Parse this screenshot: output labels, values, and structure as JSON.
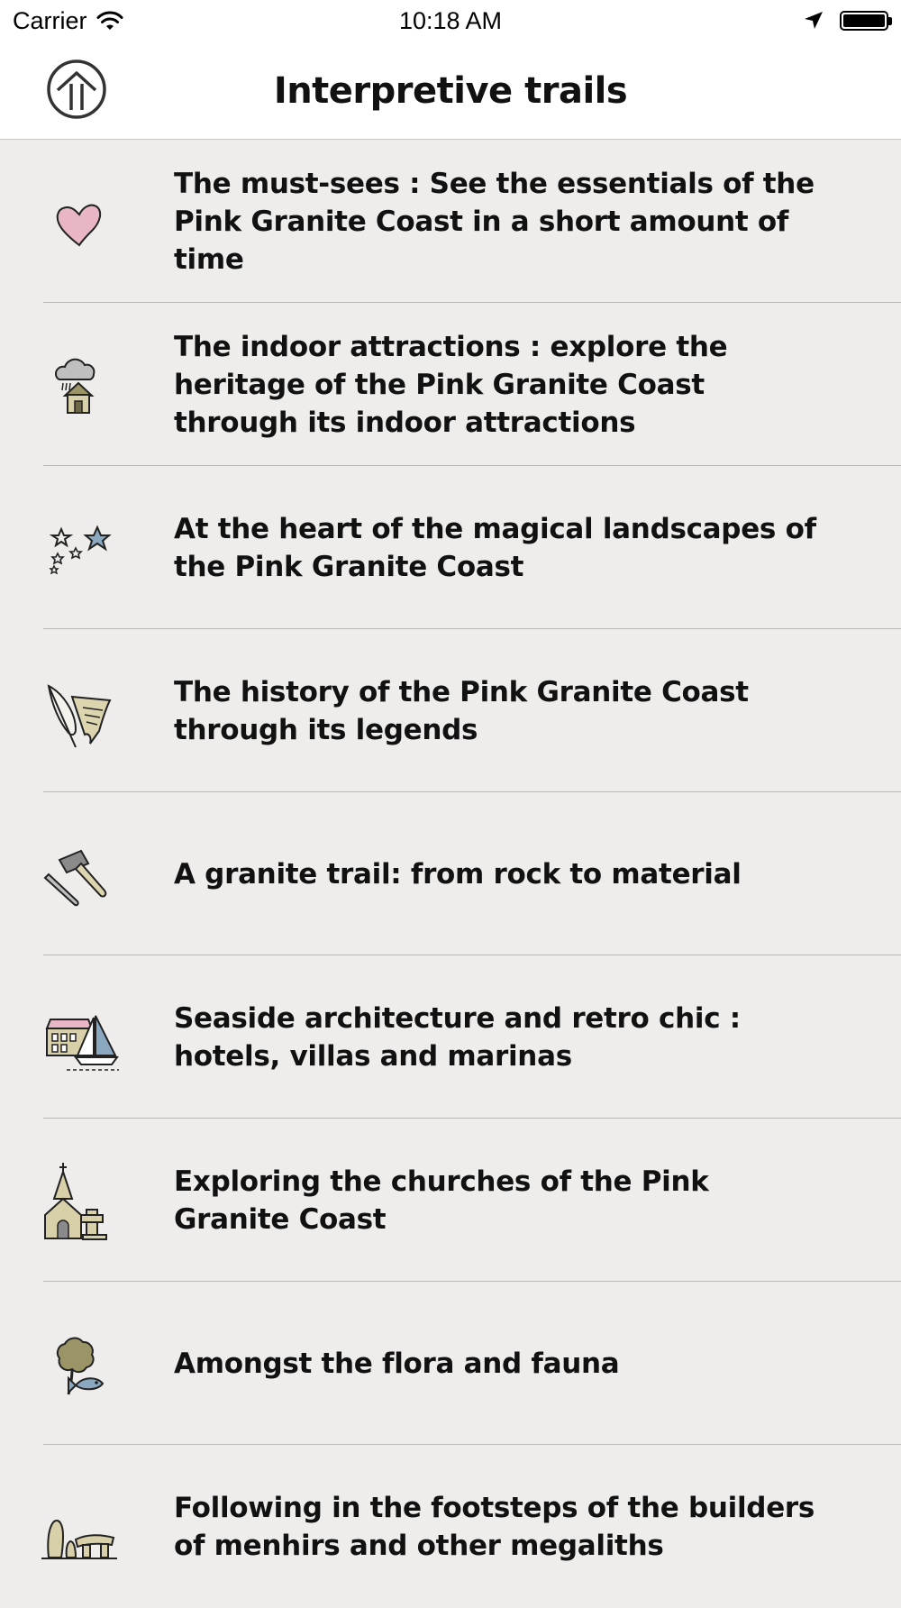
{
  "status_bar": {
    "carrier": "Carrier",
    "time": "10:18 AM"
  },
  "nav": {
    "title": "Interpretive trails",
    "home_icon": "home-up-arrow-icon"
  },
  "trails": [
    {
      "icon": "heart-icon",
      "label": "The must-sees : See the essentials of the Pink Granite Coast in a short amount of time"
    },
    {
      "icon": "rain-house-icon",
      "label": "The indoor attractions : explore the heritage of the Pink Granite Coast through its indoor attractions"
    },
    {
      "icon": "stars-icon",
      "label": "At the heart of the magical landscapes of the Pink Granite Coast"
    },
    {
      "icon": "quill-scroll-icon",
      "label": "The history of the Pink Granite Coast through its legends"
    },
    {
      "icon": "hammer-chisel-icon",
      "label": "A granite trail: from rock to material"
    },
    {
      "icon": "hotel-sailboat-icon",
      "label": "Seaside architecture and retro chic : hotels, villas and marinas"
    },
    {
      "icon": "church-cross-icon",
      "label": "Exploring the churches of the Pink Granite Coast"
    },
    {
      "icon": "tree-fish-icon",
      "label": "Amongst the flora and fauna"
    },
    {
      "icon": "menhir-dolmen-icon",
      "label": "Following in the footsteps of the builders of menhirs and other megaliths"
    }
  ],
  "colors": {
    "background": "#eeedeb",
    "bars": "#ffffff",
    "separator": "#b9b8b6",
    "heart_pink": "#e8b6c4",
    "stone_beige": "#d8d0a8",
    "olive": "#9a9466",
    "steel_blue": "#8aa8c0"
  }
}
